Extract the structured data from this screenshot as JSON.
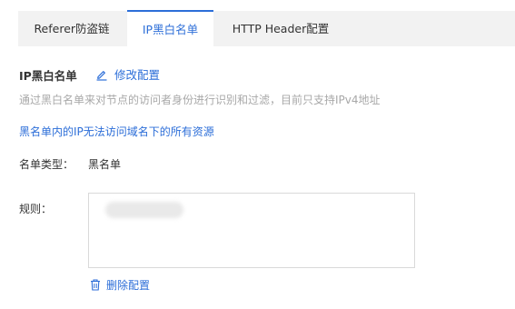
{
  "tabs": [
    {
      "label": "Referer防盗链",
      "active": false
    },
    {
      "label": "IP黑白名单",
      "active": true
    },
    {
      "label": "HTTP Header配置",
      "active": false
    }
  ],
  "section": {
    "title": "IP黑白名单",
    "edit_label": "修改配置",
    "description": "通过黑白名单来对节点的访问者身份进行识别和过滤，目前只支持IPv4地址",
    "notice": "黑名单内的IP无法访问域名下的所有资源"
  },
  "fields": {
    "type_label": "名单类型：",
    "type_value": "黑名单",
    "rules_label": "规则："
  },
  "actions": {
    "delete_label": "删除配置"
  },
  "colors": {
    "accent": "#2c6ed8",
    "tabbar_bg": "#f2f2f2",
    "muted_text": "#a8a8a8"
  },
  "icons": {
    "edit": "pencil-icon",
    "delete": "trash-icon"
  }
}
